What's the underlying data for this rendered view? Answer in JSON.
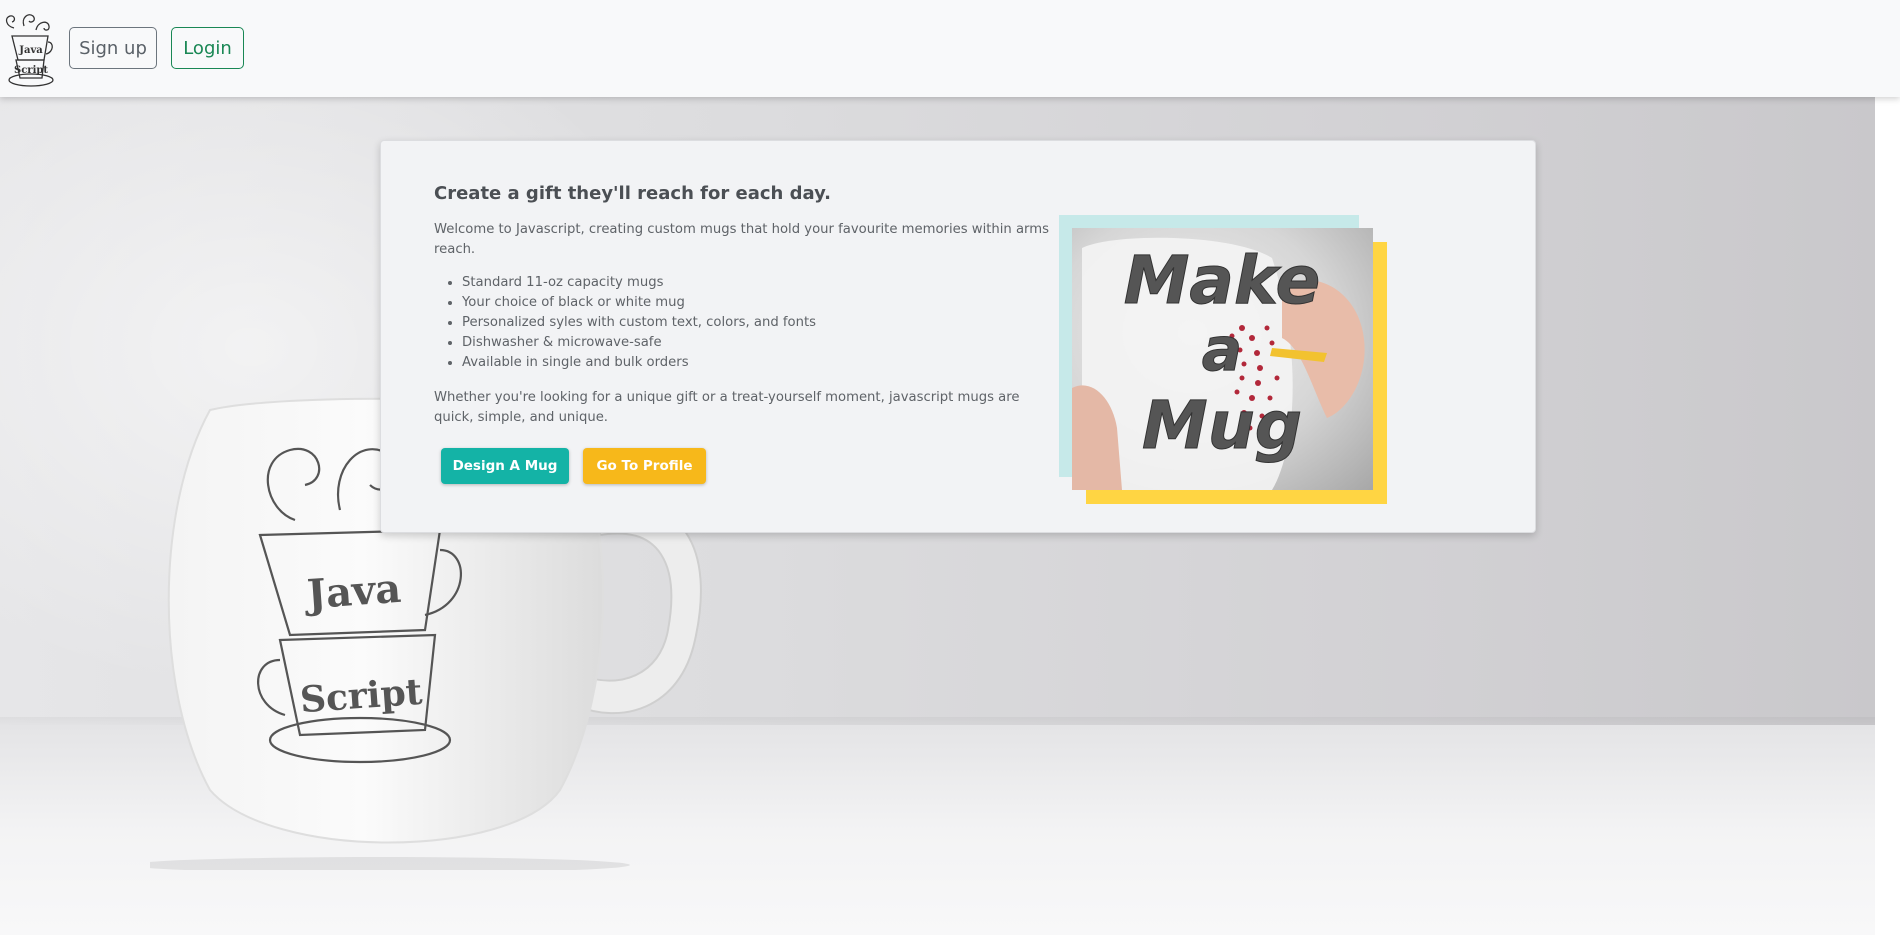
{
  "navbar": {
    "logo_text": [
      "Java",
      "Script"
    ],
    "signup_label": "Sign up",
    "login_label": "Login"
  },
  "hero": {
    "mug_print": [
      "Java",
      "Script"
    ]
  },
  "card": {
    "title": "Create a gift they'll reach for each day.",
    "intro": "Welcome to Javascript, creating custom mugs that hold your favourite memories within arms reach.",
    "features": [
      "Standard 11-oz capacity mugs",
      "Your choice of black or white mug",
      "Personalized syles with custom text, colors, and fonts",
      "Dishwasher & microwave-safe",
      "Available in single and bulk orders"
    ],
    "outro": "Whether you're looking for a unique gift or a treat-yourself moment, javascript mugs are quick, simple, and unique.",
    "design_label": "Design A Mug",
    "profile_label": "Go To Profile",
    "image_text": [
      "Make",
      "a",
      "Mug"
    ]
  },
  "colors": {
    "teal": "#14b3a6",
    "yellow": "#f7b81a",
    "success": "#198754",
    "secondary": "#6c757d"
  }
}
